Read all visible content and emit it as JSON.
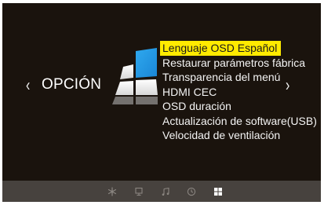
{
  "osd": {
    "category_label": "OPCIÓN",
    "nav_left_glyph": "‹",
    "nav_right_glyph": "›",
    "graphic_icon": "option-windows-icon"
  },
  "menu": {
    "items": [
      {
        "label": "Lenguaje OSD Español",
        "selected": true
      },
      {
        "label": "Restaurar parámetros fábrica",
        "selected": false
      },
      {
        "label": "Transparencia del menú",
        "selected": false
      },
      {
        "label": "HDMI CEC",
        "selected": false
      },
      {
        "label": "OSD duración",
        "selected": false
      },
      {
        "label": "Actualización de software(USB)",
        "selected": false
      },
      {
        "label": "Velocidad de ventilación",
        "selected": false
      }
    ]
  },
  "bottom_tabs": [
    {
      "icon": "picture-settings-icon",
      "active": false
    },
    {
      "icon": "screen-icon",
      "active": false
    },
    {
      "icon": "music-note-icon",
      "active": false
    },
    {
      "icon": "clock-icon",
      "active": false
    },
    {
      "icon": "option-windows-icon",
      "active": true
    }
  ],
  "colors": {
    "background": "#1a130d",
    "highlight": "#ffea00",
    "bottom_bar": "#47423e",
    "text": "#f4f4f4",
    "inactive_icon": "#8a8580",
    "active_icon": "#ffffff"
  }
}
